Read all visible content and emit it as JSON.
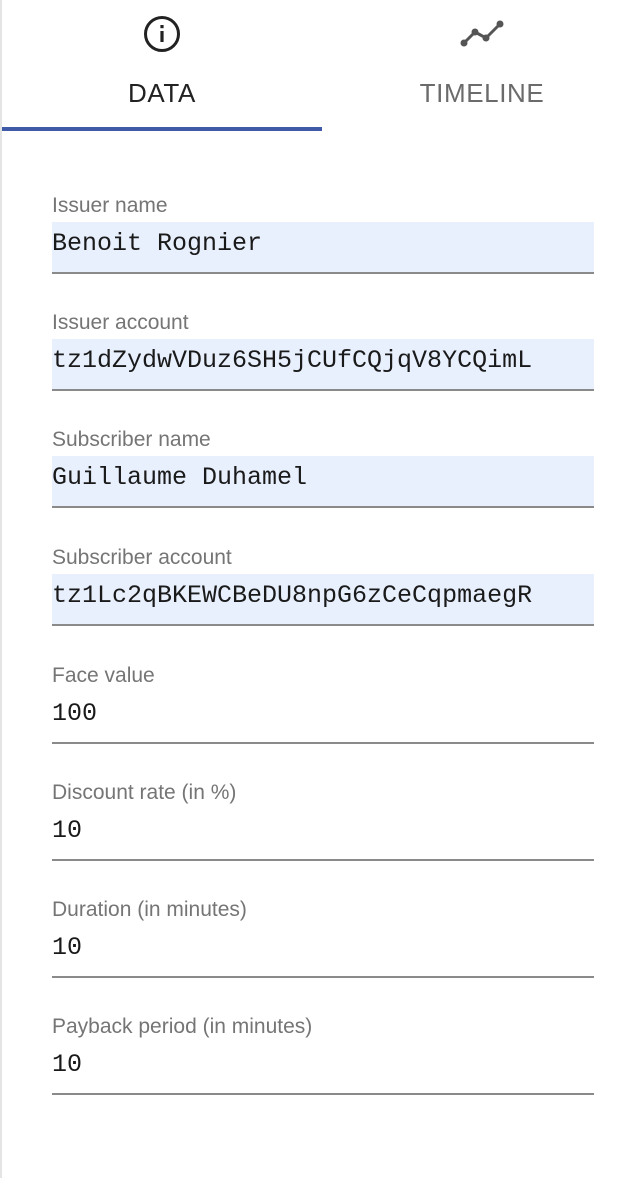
{
  "tabs": [
    {
      "label": "DATA",
      "icon": "info-icon",
      "active": true
    },
    {
      "label": "TIMELINE",
      "icon": "timeline-icon",
      "active": false
    }
  ],
  "colors": {
    "accent": "#3f5aa6",
    "autofill_background": "#e8f0fe",
    "label": "#757575"
  },
  "fields": {
    "issuer_name": {
      "label": "Issuer name",
      "value": "Benoit Rognier"
    },
    "issuer_account": {
      "label": "Issuer account",
      "value": "tz1dZydwVDuz6SH5jCUfCQjqV8YCQimL"
    },
    "subscriber_name": {
      "label": "Subscriber name",
      "value": "Guillaume Duhamel"
    },
    "subscriber_account": {
      "label": "Subscriber account",
      "value": "tz1Lc2qBKEWCBeDU8npG6zCeCqpmaegR"
    },
    "face_value": {
      "label": "Face value",
      "value": "100"
    },
    "discount_rate": {
      "label": "Discount rate (in %)",
      "value": "10"
    },
    "duration": {
      "label": "Duration (in minutes)",
      "value": "10"
    },
    "payback_period": {
      "label": "Payback period (in minutes)",
      "value": "10"
    }
  }
}
